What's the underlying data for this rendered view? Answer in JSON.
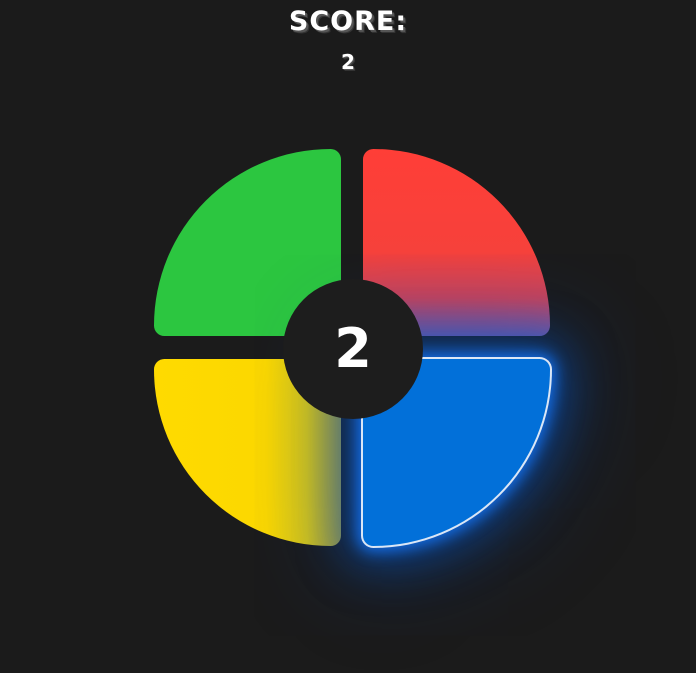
{
  "header": {
    "score_label": "SCORE:",
    "score_value": "2"
  },
  "board": {
    "center_display": "2",
    "pads": [
      {
        "id": "green",
        "color": "#2cc640",
        "lit": false
      },
      {
        "id": "red",
        "color": "#ff3e37",
        "lit": false
      },
      {
        "id": "yellow",
        "color": "#ffda00",
        "lit": false
      },
      {
        "id": "blue",
        "color": "#0270d9",
        "lit": true
      }
    ]
  }
}
